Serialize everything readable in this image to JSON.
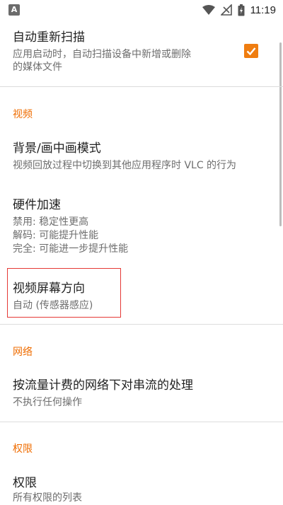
{
  "status_bar": {
    "time": "11:19",
    "left_icon": "A"
  },
  "prefs": {
    "auto_rescan": {
      "title": "自动重新扫描",
      "summary_line1": "应用启动时，自动扫描设备中新增或删除",
      "summary_line2": "的媒体文件",
      "checked": true
    },
    "video_category": "视频",
    "background_pip": {
      "title": "背景/画中画模式",
      "summary": "视频回放过程中切换到其他应用程序时 VLC 的行为"
    },
    "hw_accel": {
      "title": "硬件加速",
      "summary_lines": [
        "禁用: 稳定性更高",
        "解码: 可能提升性能",
        "完全: 可能进一步提升性能"
      ]
    },
    "screen_orientation": {
      "title": "视频屏幕方向",
      "summary": "自动 (传感器感应)"
    },
    "network_category": "网络",
    "metered_network": {
      "title": "按流量计费的网络下对串流的处理",
      "summary": "不执行任何操作"
    },
    "permissions_category": "权限",
    "permissions": {
      "title": "权限",
      "summary": "所有权限的列表"
    }
  },
  "colors": {
    "accent": "#ef6c00",
    "highlight": "#e53935"
  }
}
